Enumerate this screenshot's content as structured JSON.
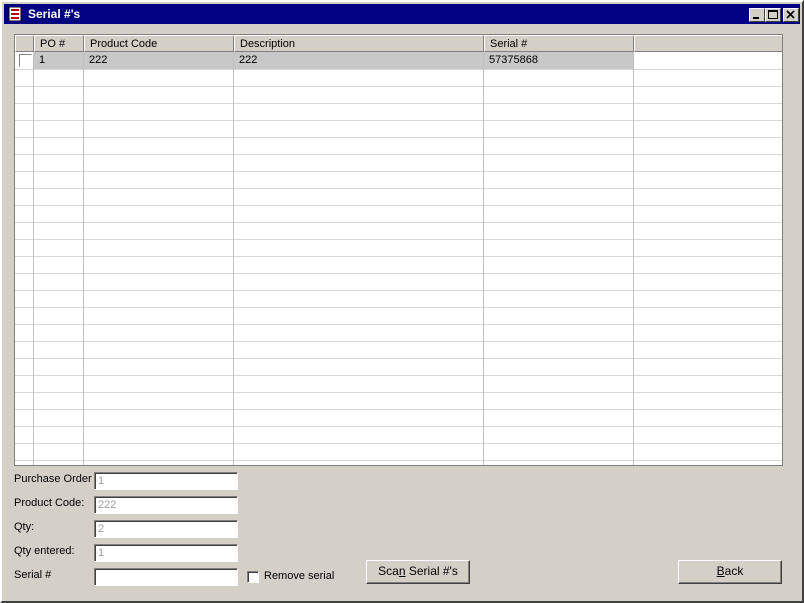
{
  "window": {
    "title": "Serial #'s"
  },
  "grid": {
    "columns": [
      "PO #",
      "Product Code",
      "Description",
      "Serial #",
      ""
    ],
    "rows": [
      {
        "po": "1",
        "product_code": "222",
        "description": "222",
        "serial": "57375868"
      }
    ]
  },
  "form": {
    "purchase_order_label": "Purchase Order",
    "purchase_order_value": "1",
    "product_code_label": "Product Code:",
    "product_code_value": "222",
    "qty_label": "Qty:",
    "qty_value": "2",
    "qty_entered_label": "Qty entered:",
    "qty_entered_value": "1",
    "serial_label": "Serial #",
    "serial_value": "",
    "remove_serial_label": "Remove serial"
  },
  "buttons": {
    "scan_pre": "Sca",
    "scan_key": "n",
    "scan_post": " Serial #'s",
    "back_key": "B",
    "back_post": "ack"
  }
}
